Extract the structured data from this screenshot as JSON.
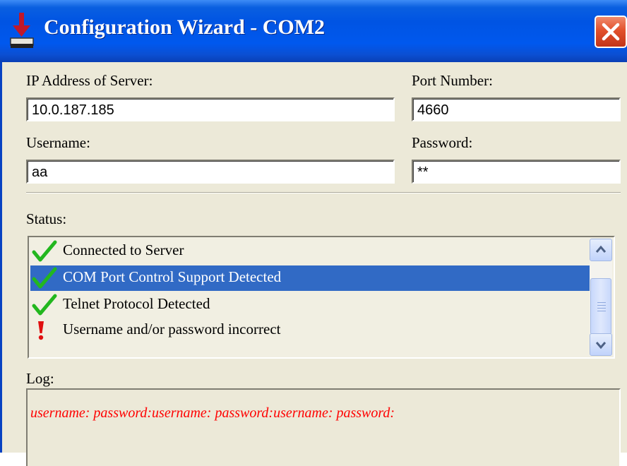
{
  "window": {
    "title": "Configuration Wizard - COM2"
  },
  "form": {
    "server_label": "IP Address of Server:",
    "server_value": "10.0.187.185",
    "port_label": "Port Number:",
    "port_value": "4660",
    "username_label": "Username:",
    "username_value": "aa",
    "password_label": "Password:",
    "password_value": "**"
  },
  "status": {
    "label": "Status:",
    "items": [
      {
        "text": "Connected to Server",
        "icon": "check-icon"
      },
      {
        "text": "COM Port Control Support Detected",
        "icon": "check-icon",
        "selected": true
      },
      {
        "text": "Telnet Protocol Detected",
        "icon": "check-icon"
      },
      {
        "text": "Username and/or password incorrect",
        "icon": "exclamation-icon"
      }
    ]
  },
  "log": {
    "label": "Log:",
    "text": "username: password:username: password:username: password:"
  },
  "colors": {
    "title_bar": "#0054e3",
    "selection": "#316ac5",
    "log_text": "#ff0000",
    "check": "#22b71e",
    "exclamation": "#e01010"
  }
}
